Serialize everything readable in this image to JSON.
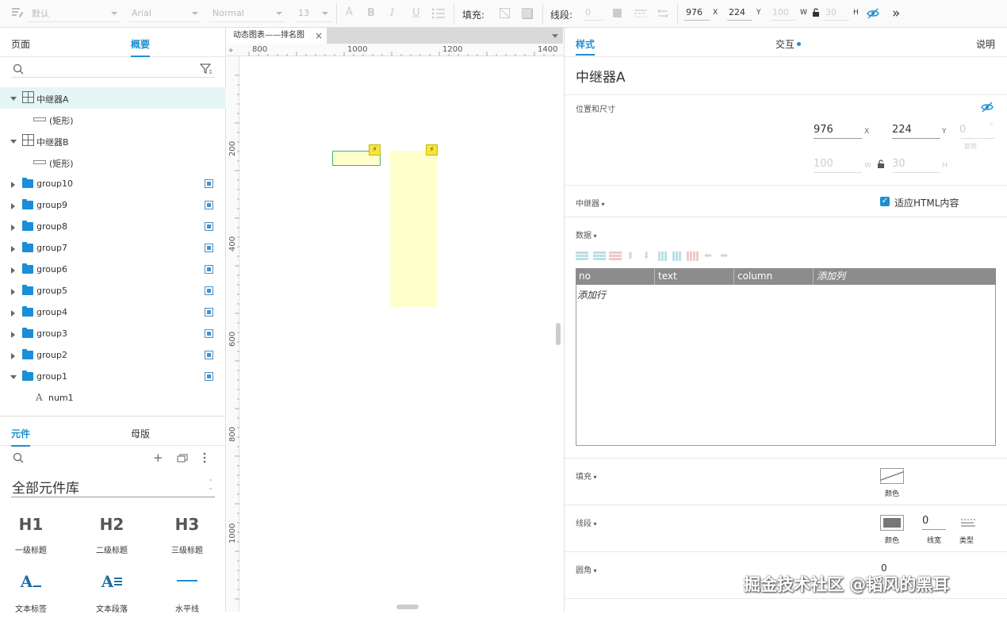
{
  "toolbar": {
    "style_select": "默认",
    "font_select": "Arial",
    "weight_select": "Normal",
    "size_select": "13",
    "fill_label": "填充:",
    "stroke_label": "线段:",
    "stroke_value": "0",
    "x_value": "976",
    "x_label": "X",
    "y_value": "224",
    "y_label": "Y",
    "w_value": "100",
    "w_label": "W",
    "h_value": "30",
    "h_label": "H"
  },
  "left_panel": {
    "tabs": [
      "页面",
      "概要"
    ],
    "active_tab": "概要",
    "tree": [
      {
        "label": "中继器A",
        "type": "repeater",
        "expanded": true,
        "selected": true
      },
      {
        "label": "(矩形)",
        "type": "rect",
        "child": true
      },
      {
        "label": "中继器B",
        "type": "repeater",
        "expanded": true
      },
      {
        "label": "(矩形)",
        "type": "rect",
        "child": true
      },
      {
        "label": "group10",
        "type": "folder"
      },
      {
        "label": "group9",
        "type": "folder"
      },
      {
        "label": "group8",
        "type": "folder"
      },
      {
        "label": "group7",
        "type": "folder"
      },
      {
        "label": "group6",
        "type": "folder"
      },
      {
        "label": "group5",
        "type": "folder"
      },
      {
        "label": "group4",
        "type": "folder"
      },
      {
        "label": "group3",
        "type": "folder"
      },
      {
        "label": "group2",
        "type": "folder"
      },
      {
        "label": "group1",
        "type": "folder",
        "expanded": true
      },
      {
        "label": "num1",
        "type": "text",
        "child": true
      }
    ],
    "lib_tabs": [
      "元件",
      "母版"
    ],
    "active_lib_tab": "元件",
    "library_select": "全部元件库",
    "widgets": [
      {
        "icon": "H1",
        "label": "一级标题"
      },
      {
        "icon": "H2",
        "label": "二级标题"
      },
      {
        "icon": "H3",
        "label": "三级标题"
      },
      {
        "icon": "A_",
        "label": "文本标签"
      },
      {
        "icon": "A≡",
        "label": "文本段落"
      },
      {
        "icon": "hline",
        "label": "水平线"
      }
    ]
  },
  "canvas": {
    "doc_tab": "动态图表——排名图",
    "ruler_top": [
      "800",
      "1000",
      "1200",
      "1400"
    ],
    "ruler_left": [
      "200",
      "400",
      "600",
      "800",
      "1000"
    ]
  },
  "right_panel": {
    "tabs": [
      "样式",
      "交互",
      "说明"
    ],
    "active_tab": "样式",
    "title": "中继器A",
    "position_section": "位置和尺寸",
    "x": "976",
    "x_unit": "X",
    "y": "224",
    "y_unit": "Y",
    "rotation": "0",
    "rotation_unit": "°",
    "rotation_label": "旋转",
    "w": "100",
    "w_unit": "W",
    "h": "30",
    "h_unit": "H",
    "repeater_section": "中继器",
    "fit_html": "适应HTML内容",
    "data_section": "数据",
    "columns": [
      "no",
      "text",
      "column",
      "添加列"
    ],
    "add_row": "添加行",
    "fill_section": "填充",
    "fill_color_label": "颜色",
    "stroke_section": "线段",
    "stroke_color_label": "颜色",
    "stroke_width": "0",
    "stroke_width_label": "线宽",
    "stroke_type_label": "类型",
    "corner_section": "圆角",
    "corner_value": "0"
  },
  "watermark": "掘金技术社区 @韬风的黑耳",
  "colors": {
    "accent": "#1d8fd0",
    "selection_bg": "#e3f6f5",
    "folder": "#1a8ed8",
    "canvas_rect_fill": "#ffffcc",
    "canvas_rect_selected_border": "#3cb878",
    "lightning_badge": "#f7e53b"
  }
}
